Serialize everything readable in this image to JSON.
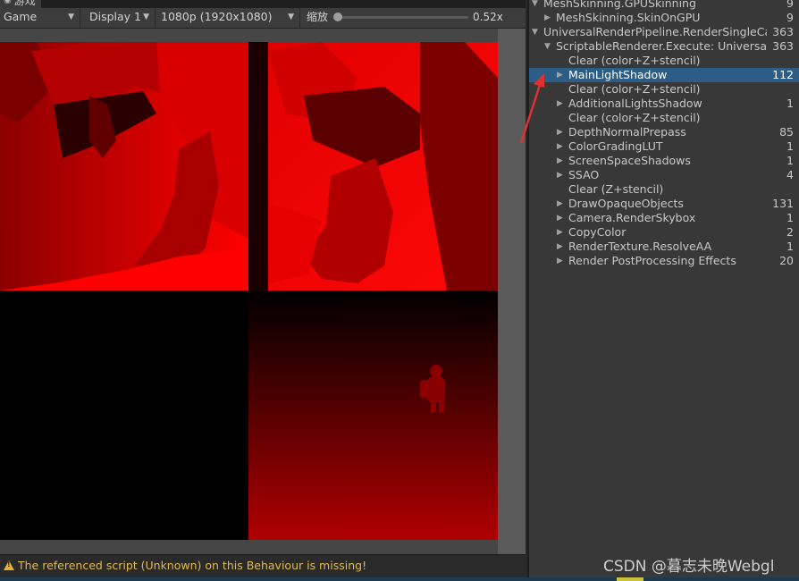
{
  "tab": {
    "label": "游戏",
    "icon": "gamepad-icon"
  },
  "toolbar": {
    "game_dropdown": "Game",
    "display_dropdown": "Display 1",
    "resolution_dropdown": "1080p (1920x1080)",
    "scale_label": "缩放",
    "scale_value": "0.52x",
    "scale_fraction": 0.0
  },
  "status": {
    "warning_icon": "warning-icon",
    "message": "The referenced script (Unknown) on this Behaviour is missing!"
  },
  "tree": {
    "rows": [
      {
        "label": "MeshSkinning.GPUSkinning",
        "value": "9",
        "depth": 0,
        "expanded": true
      },
      {
        "label": "MeshSkinning.SkinOnGPU",
        "value": "9",
        "depth": 1,
        "expanded": false
      },
      {
        "label": "UniversalRenderPipeline.RenderSingleCamera",
        "value": "363",
        "depth": 0,
        "expanded": true
      },
      {
        "label": "ScriptableRenderer.Execute: UniversalRenderer",
        "value": "363",
        "depth": 1,
        "expanded": true
      },
      {
        "label": "Clear (color+Z+stencil)",
        "value": "",
        "depth": 2,
        "expanded": null
      },
      {
        "label": "MainLightShadow",
        "value": "112",
        "depth": 2,
        "expanded": false,
        "selected": true
      },
      {
        "label": "Clear (color+Z+stencil)",
        "value": "",
        "depth": 2,
        "expanded": null
      },
      {
        "label": "AdditionalLightsShadow",
        "value": "1",
        "depth": 2,
        "expanded": false
      },
      {
        "label": "Clear (color+Z+stencil)",
        "value": "",
        "depth": 2,
        "expanded": null
      },
      {
        "label": "DepthNormalPrepass",
        "value": "85",
        "depth": 2,
        "expanded": false
      },
      {
        "label": "ColorGradingLUT",
        "value": "1",
        "depth": 2,
        "expanded": false
      },
      {
        "label": "ScreenSpaceShadows",
        "value": "1",
        "depth": 2,
        "expanded": false
      },
      {
        "label": "SSAO",
        "value": "4",
        "depth": 2,
        "expanded": false
      },
      {
        "label": "Clear (Z+stencil)",
        "value": "",
        "depth": 2,
        "expanded": null
      },
      {
        "label": "DrawOpaqueObjects",
        "value": "131",
        "depth": 2,
        "expanded": false
      },
      {
        "label": "Camera.RenderSkybox",
        "value": "1",
        "depth": 2,
        "expanded": false
      },
      {
        "label": "CopyColor",
        "value": "2",
        "depth": 2,
        "expanded": false
      },
      {
        "label": "RenderTexture.ResolveAA",
        "value": "1",
        "depth": 2,
        "expanded": false
      },
      {
        "label": "Render PostProcessing Effects",
        "value": "20",
        "depth": 2,
        "expanded": false
      }
    ]
  },
  "watermark": "CSDN @暮志未晚Webgl",
  "colors": {
    "selection": "#2c5d87",
    "shadow_red": "#ff0000",
    "warning": "#e0b94a",
    "annotation_arrow": "#e03030"
  }
}
